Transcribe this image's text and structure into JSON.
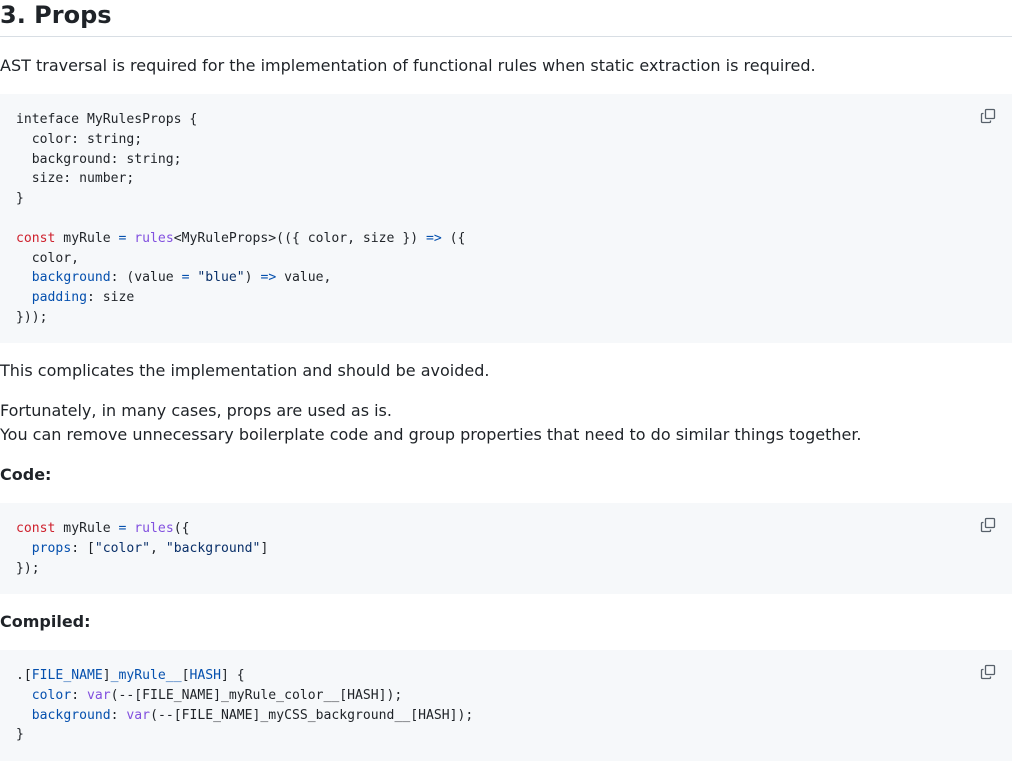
{
  "heading": "3. Props",
  "paragraphs": {
    "intro": "AST traversal is required for the implementation of functional rules when static extraction is required.",
    "complicates": "This complicates the implementation and should be avoided.",
    "fortunately": "Fortunately, in many cases, props are used as is.",
    "remove": "You can remove unnecessary boilerplate code and group properties that need to do similar things together."
  },
  "labels": {
    "code": "Code:",
    "compiled": "Compiled:"
  },
  "icons": {
    "copy": "copy-icon"
  },
  "code_blocks": {
    "first": {
      "l1": "inteface MyRulesProps {",
      "l2": "  color: string;",
      "l3": "  background: string;",
      "l4": "  size: number;",
      "l5": "}",
      "l6a": "const",
      "l6b": " myRule ",
      "l6c": "=",
      "l6d": " ",
      "l6e": "rules",
      "l6f": "<MyRuleProps>(({ color, size }) ",
      "l6g": "=>",
      "l6h": " ({",
      "l7": "  color,",
      "l8a": "  ",
      "l8b": "background",
      "l8c": ": (value ",
      "l8d": "=",
      "l8e": " ",
      "l8f": "\"blue\"",
      "l8g": ") ",
      "l8h": "=>",
      "l8i": " value,",
      "l9a": "  ",
      "l9b": "padding",
      "l9c": ": size",
      "l10": "}));"
    },
    "second": {
      "l1a": "const",
      "l1b": " myRule ",
      "l1c": "=",
      "l1d": " ",
      "l1e": "rules",
      "l1f": "({",
      "l2a": "  ",
      "l2b": "props",
      "l2c": ": [",
      "l2d": "\"color\"",
      "l2e": ", ",
      "l2f": "\"background\"",
      "l2g": "]",
      "l3": "});"
    },
    "third": {
      "l1a": ".[",
      "l1b": "FILE_NAME",
      "l1c": "]",
      "l1d": "_myRule__",
      "l1e": "[",
      "l1f": "HASH",
      "l1g": "] {",
      "l2a": "  ",
      "l2b": "color",
      "l2c": ": ",
      "l2d": "var",
      "l2e": "(--[FILE_NAME]_myRule_color__[HASH]);",
      "l3a": "  ",
      "l3b": "background",
      "l3c": ": ",
      "l3d": "var",
      "l3e": "(--[FILE_NAME]_myCSS_background__[HASH]);",
      "l4": "}"
    }
  }
}
